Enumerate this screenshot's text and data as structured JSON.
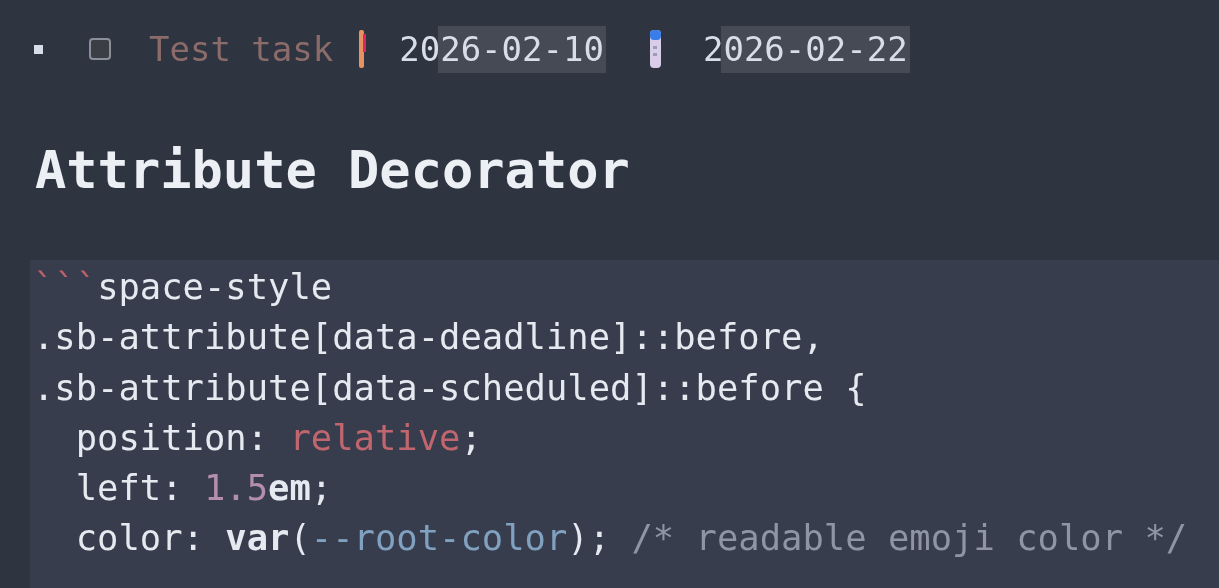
{
  "task": {
    "checked": false,
    "label": "Test task",
    "deadline": "2026-02-10",
    "scheduled": "2026-02-22"
  },
  "heading": "Attribute Decorator",
  "code_lines": [
    [
      {
        "kind": "fence",
        "text": "```"
      },
      {
        "kind": "plain",
        "text": "space-style"
      }
    ],
    [
      {
        "kind": "plain",
        "text": ".sb-attribute[data-deadline]::before,"
      }
    ],
    [
      {
        "kind": "plain",
        "text": ".sb-attribute[data-scheduled]::before {"
      }
    ],
    [
      {
        "kind": "plain",
        "text": "  position: "
      },
      {
        "kind": "keyword",
        "text": "relative"
      },
      {
        "kind": "plain",
        "text": ";"
      }
    ],
    [
      {
        "kind": "plain",
        "text": "  left: "
      },
      {
        "kind": "number",
        "text": "1.5"
      },
      {
        "kind": "bold",
        "text": "em"
      },
      {
        "kind": "plain",
        "text": ";"
      }
    ],
    [
      {
        "kind": "plain",
        "text": "  color: "
      },
      {
        "kind": "bold",
        "text": "var"
      },
      {
        "kind": "plain",
        "text": "("
      },
      {
        "kind": "variable",
        "text": "--root-color"
      },
      {
        "kind": "plain",
        "text": "); "
      },
      {
        "kind": "comment",
        "text": "/* readable emoji color */"
      }
    ]
  ]
}
